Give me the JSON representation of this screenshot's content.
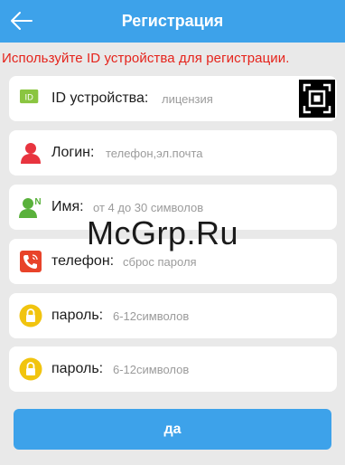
{
  "header": {
    "title": "Регистрация",
    "back_icon": "arrow-left-icon"
  },
  "notice": "Используйте ID устройства для регистрации.",
  "form": {
    "device_id": {
      "label": "ID устройства:",
      "placeholder": "лицензия",
      "icon": "id-badge-icon",
      "scan_icon": "qr-scan-icon"
    },
    "login": {
      "label": "Логин:",
      "placeholder": "телефон,эл.почта",
      "icon": "user-icon"
    },
    "name": {
      "label": "Имя:",
      "placeholder": "от 4 до 30 символов",
      "icon": "user-name-icon"
    },
    "phone": {
      "label": "телефон:",
      "placeholder": "сброс пароля",
      "icon": "phone-icon"
    },
    "password": {
      "label": "пароль:",
      "placeholder": "6-12символов",
      "icon": "lock-icon"
    },
    "password_confirm": {
      "label": "пароль:",
      "placeholder": "6-12символов",
      "icon": "lock-icon"
    }
  },
  "submit_label": "да",
  "watermark": "McGrp.Ru",
  "colors": {
    "accent": "#3da2ea",
    "notice": "#e5231b",
    "id_icon": "#8ac540",
    "user_icon": "#e8343f",
    "name_icon": "#59b13b",
    "phone_icon": "#e8432a",
    "lock_icon": "#f1c40f"
  }
}
